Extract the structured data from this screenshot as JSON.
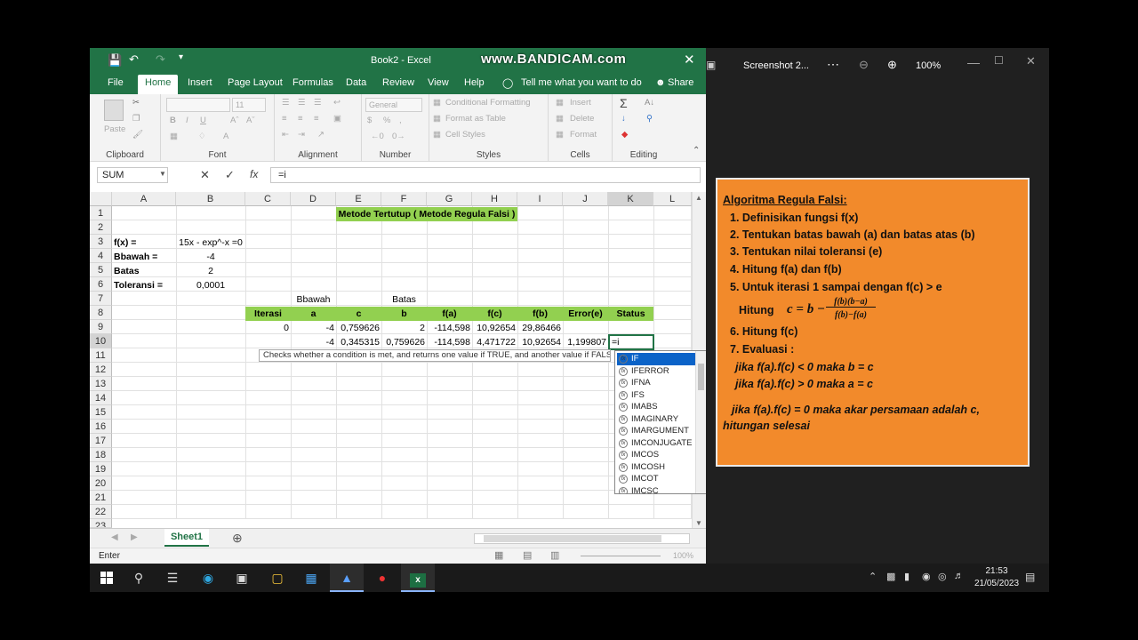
{
  "excel": {
    "title": "Book2 - Excel",
    "watermark": "www.BANDICAM.com",
    "menus": [
      "File",
      "Home",
      "Insert",
      "Page Layout",
      "Formulas",
      "Data",
      "Review",
      "View",
      "Help"
    ],
    "tell_me": "Tell me what you want to do",
    "share": "Share",
    "ribbon": {
      "paste": "Paste",
      "clipboard": "Clipboard",
      "font": "Font",
      "font_size": "11",
      "alignment": "Alignment",
      "number_format": "General",
      "number": "Number",
      "conditional_formatting": "Conditional Formatting",
      "format_as_table": "Format as Table",
      "cell_styles": "Cell Styles",
      "styles": "Styles",
      "insert": "Insert",
      "delete": "Delete",
      "format": "Format",
      "cells": "Cells",
      "editing": "Editing"
    },
    "name_box": "SUM",
    "formula": "=i",
    "columns": [
      "A",
      "B",
      "C",
      "D",
      "E",
      "F",
      "G",
      "H",
      "I",
      "J",
      "K",
      "L"
    ],
    "rows": [
      "1",
      "2",
      "3",
      "4",
      "5",
      "6",
      "7",
      "8",
      "9",
      "10",
      "11",
      "12",
      "13",
      "14",
      "15",
      "16",
      "17",
      "18",
      "19",
      "20",
      "21",
      "22",
      "23"
    ],
    "cells": {
      "title": "Metode Tertutup ( Metode Regula Falsi )",
      "a3": "f(x) =",
      "b3": "15x - exp^-x =0",
      "a4": "Bbawah =",
      "b4": "-4",
      "a5": "Batas",
      "b5": "2",
      "a6": "Toleransi =",
      "b6": "0,0001",
      "d7": "Bbawah",
      "f7": "Batas",
      "headers": [
        "Iterasi",
        "a",
        "c",
        "b",
        "f(a)",
        "f(c)",
        "f(b)",
        "Error(e)",
        "Status"
      ],
      "row9": [
        "0",
        "-4",
        "0,759626",
        "2",
        "-114,598",
        "10,92654",
        "29,86466",
        "",
        ""
      ],
      "row10": [
        "",
        "-4",
        "0,345315",
        "0,759626",
        "-114,598",
        "4,471722",
        "10,92654",
        "1,199807",
        "=i"
      ]
    },
    "tooltip": "Checks whether a condition is met, and returns one value if TRUE, and another value if FALSE",
    "autocomplete": [
      "IF",
      "IFERROR",
      "IFNA",
      "IFS",
      "IMABS",
      "IMAGINARY",
      "IMARGUMENT",
      "IMCONJUGATE",
      "IMCOS",
      "IMCOSH",
      "IMCOT",
      "IMCSC"
    ],
    "sheet_tab": "Sheet1",
    "status": "Enter",
    "zoom_status": "100%"
  },
  "photos": {
    "title": "Screenshot 2...",
    "zoom": "100%",
    "card": {
      "heading": "Algoritma Regula Falsi:",
      "steps": [
        "1. Definisikan fungsi f(x)",
        "2. Tentukan batas bawah (a) dan batas atas (b)",
        "3. Tentukan nilai toleransi (e)",
        "4. Hitung f(a) dan f(b)",
        "5. Untuk iterasi 1 sampai dengan f(c) > e"
      ],
      "hitung_label": "Hitung",
      "formula_lhs": "c = b −",
      "formula_num": "f(b)(b−a)",
      "formula_den": "f(b)−f(a)",
      "step6": "6. Hitung f(c)",
      "step7": "7. Evaluasi :",
      "eval1": "jika f(a).f(c) < 0 maka b = c",
      "eval2": "jika f(a).f(c) > 0 maka a = c",
      "eval3": "jika f(a).f(c) = 0 maka akar persamaan adalah c,",
      "eval4": "hitungan selesai"
    }
  },
  "taskbar": {
    "time": "21:53",
    "date": "21/05/2023"
  }
}
